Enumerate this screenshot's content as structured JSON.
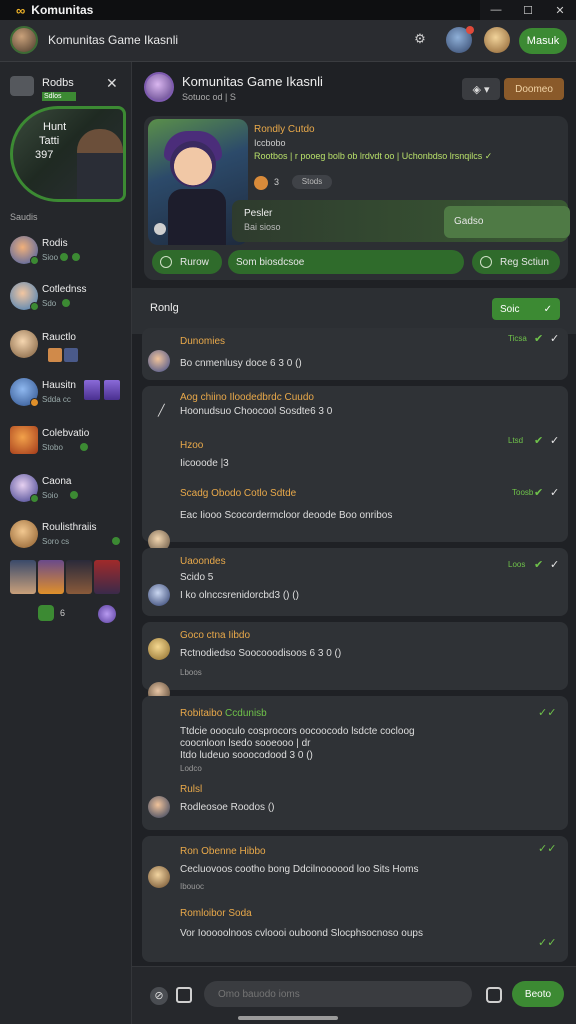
{
  "window": {
    "logo": "∞",
    "title": "Komunitas",
    "min": "—",
    "max": "☐",
    "close": "✕"
  },
  "topbar": {
    "title": "Komunitas Game Ikasnli",
    "join_label": "Masuk"
  },
  "sidebar": {
    "header_name": "Rodbs",
    "header_tag": "Sdlos",
    "hero_lines": [
      "Hunt",
      "Tatti",
      "397"
    ],
    "section_label": "Saudis",
    "items": [
      {
        "name": "Rodis",
        "sub": "Sioo"
      },
      {
        "name": "Cotlednss",
        "sub": "Sdo"
      },
      {
        "name": "Rauctlo",
        "sub": ""
      },
      {
        "name": "Hausitn",
        "sub": "Sdda cc"
      },
      {
        "name": "Colebvatio",
        "sub": "Stobo"
      },
      {
        "name": "Caona",
        "sub": "Soio"
      },
      {
        "name": "Roulisthraiis",
        "sub": "Soro cs"
      }
    ],
    "footer_count": "6"
  },
  "channel": {
    "title": "Komunitas Game Ikasnli",
    "subtitle": "Sotuoc od | S",
    "icon_btn": "◈ ▾",
    "action_btn": "Doomeo"
  },
  "card": {
    "title": "Rondly Cutdo",
    "line2": "Iccbobo",
    "line3": "Rootbos | r pooeg bolb ob lrdvdt oo | Uchonbdso lrsnqilcs ✓",
    "mini_count": "3",
    "mini_tag": "Stods",
    "row_a": "Pesler",
    "row_b": "Bai sioso",
    "row_btn": "Gadso",
    "act1": "Rurow",
    "act2": "Som biosdcsoe",
    "act3": "Reg Sctiun"
  },
  "thread": {
    "title": "Ronlg",
    "btn": "Soic",
    "btn_icon": "✓"
  },
  "messages": [
    {
      "author": "Dunomies",
      "lines": [
        "Bo cnmenlusy doce 6 3 0 ()"
      ],
      "time": "Ticsa"
    },
    {
      "author": "Aog chiino Iloodedbrdc Cuudo",
      "lines": [
        "Hoonudsuo Choocool Sosdte6 3 0",
        "Hzoo",
        "Iicooode |3"
      ],
      "time": "Ltsd"
    },
    {
      "author": "Scadg Obodo Cotlo Sdtde",
      "lines": [
        "Eac Iiooo Scocordermcloor deoode Boo onribos"
      ],
      "time": "Toosb"
    },
    {
      "author": "Uaoondes",
      "lines": [
        "Scido 5",
        "I ko olnccsrenidorcbd3 () ()"
      ],
      "time": "Loos"
    },
    {
      "author": "Goco ctna Iibdo",
      "lines": [
        "Rctnodiedso Soocooodisoos 6 3 0 ()",
        "Lboos"
      ],
      "time": ""
    },
    {
      "author": "Robitaibo",
      "author2": "Ccdunisb",
      "lines": [
        "Ttdcie oooculo cosprocors oocoocodo lsdcte cocloog",
        "coocnloon lsedo sooeooo | dr",
        "Itdo ludeuo sooocodood 3 0 ()",
        "Lodco"
      ],
      "time": ""
    },
    {
      "author": "Rulsl",
      "lines": [
        "Rodleosoe Roodos ()"
      ],
      "time": ""
    },
    {
      "author": "Ron Obenne Hibbo",
      "lines": [
        "Cecluovoos cootho bong Ddcilnoooood loo Sits Homs",
        "Ibouoc"
      ],
      "time": ""
    },
    {
      "author": "Romloibor Soda",
      "lines": [
        "Vor Iooooolnoos cvloooi ouboond Slocphsocnoso oups"
      ],
      "time": ""
    }
  ],
  "composer": {
    "placeholder": "Omo bauodo ioms",
    "send_label": "Beoto"
  }
}
